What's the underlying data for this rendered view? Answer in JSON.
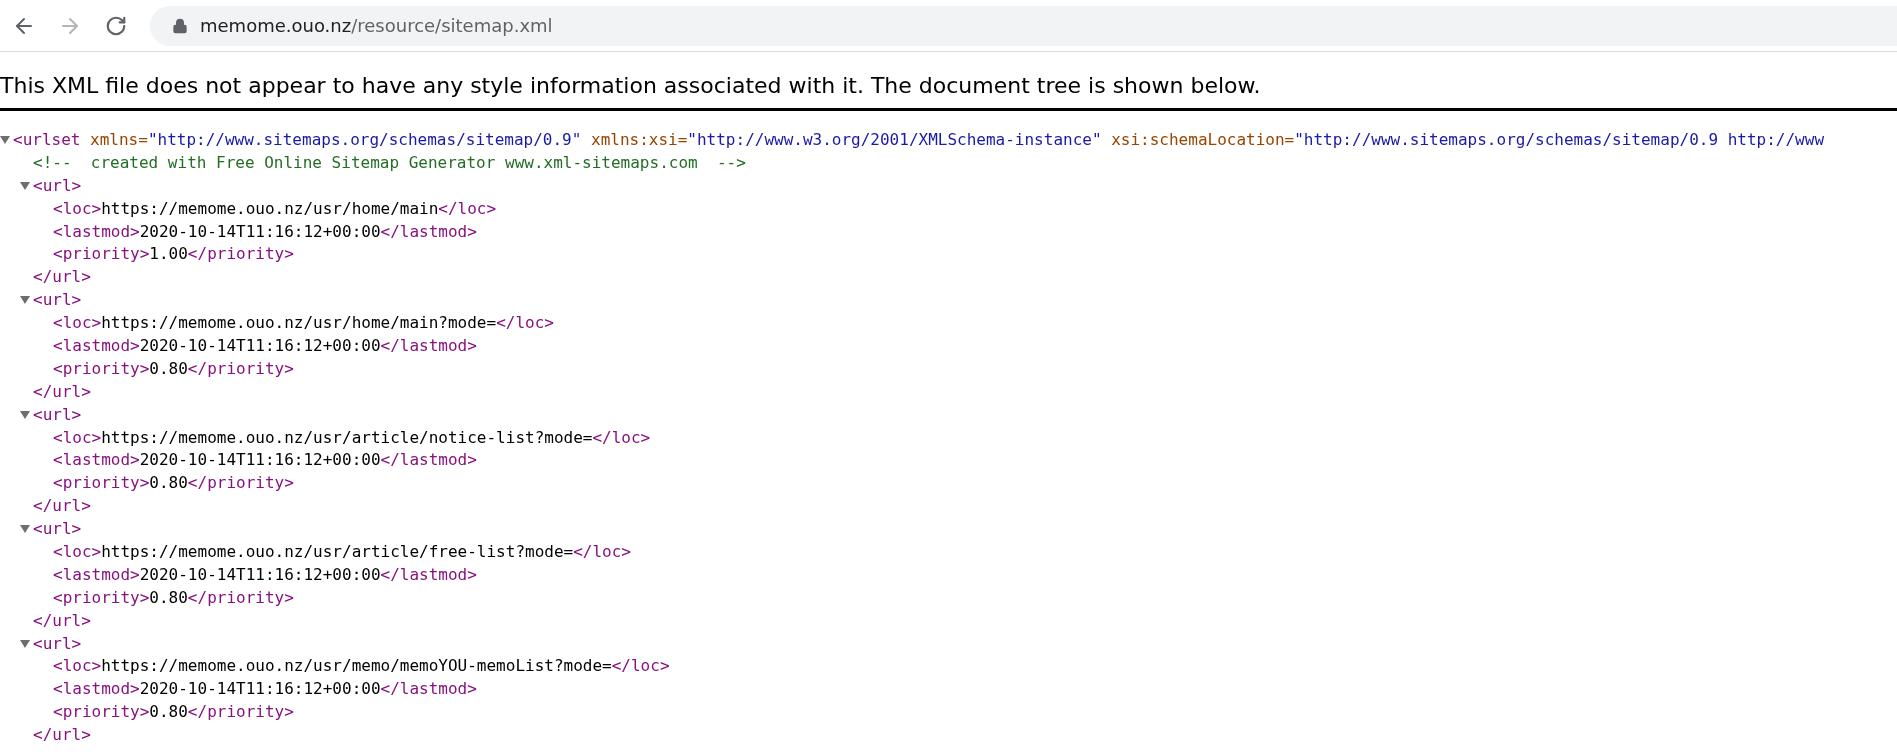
{
  "browser": {
    "back": {
      "disabled": false
    },
    "forward": {
      "disabled": true
    },
    "address": {
      "host": "memome.ouo.nz",
      "path": "/resource/sitemap.xml",
      "secure": true
    }
  },
  "info_message": "This XML file does not appear to have any style information associated with it. The document tree is shown below.",
  "xml_tree": {
    "kind": "element",
    "expanded": true,
    "open": [
      {
        "kind": "tag",
        "text": "<urlset"
      },
      {
        "kind": "attr",
        "text": " xmlns="
      },
      {
        "kind": "value",
        "text": "\"http://www.sitemaps.org/schemas/sitemap/0.9\""
      },
      {
        "kind": "attr",
        "text": " xmlns:xsi="
      },
      {
        "kind": "value",
        "text": "\"http://www.w3.org/2001/XMLSchema-instance\""
      },
      {
        "kind": "attr",
        "text": " xsi:schemaLocation="
      },
      {
        "kind": "value",
        "text": "\"http://www.sitemaps.org/schemas/sitemap/0.9 http://www"
      }
    ],
    "children": [
      {
        "kind": "comment",
        "text": "<!--  created with Free Online Sitemap Generator www.xml-sitemaps.com  -->"
      },
      {
        "kind": "element",
        "expanded": true,
        "open": [
          {
            "kind": "tag",
            "text": "<url>"
          }
        ],
        "close": [
          {
            "kind": "tag",
            "text": "</url>"
          }
        ],
        "children": [
          {
            "kind": "leaf",
            "line": [
              {
                "kind": "tag",
                "text": "<loc>"
              },
              {
                "kind": "text",
                "text": "https://memome.ouo.nz/usr/home/main"
              },
              {
                "kind": "tag",
                "text": "</loc>"
              }
            ]
          },
          {
            "kind": "leaf",
            "line": [
              {
                "kind": "tag",
                "text": "<lastmod>"
              },
              {
                "kind": "text",
                "text": "2020-10-14T11:16:12+00:00"
              },
              {
                "kind": "tag",
                "text": "</lastmod>"
              }
            ]
          },
          {
            "kind": "leaf",
            "line": [
              {
                "kind": "tag",
                "text": "<priority>"
              },
              {
                "kind": "text",
                "text": "1.00"
              },
              {
                "kind": "tag",
                "text": "</priority>"
              }
            ]
          }
        ]
      },
      {
        "kind": "element",
        "expanded": true,
        "open": [
          {
            "kind": "tag",
            "text": "<url>"
          }
        ],
        "close": [
          {
            "kind": "tag",
            "text": "</url>"
          }
        ],
        "children": [
          {
            "kind": "leaf",
            "line": [
              {
                "kind": "tag",
                "text": "<loc>"
              },
              {
                "kind": "text",
                "text": "https://memome.ouo.nz/usr/home/main?mode="
              },
              {
                "kind": "tag",
                "text": "</loc>"
              }
            ]
          },
          {
            "kind": "leaf",
            "line": [
              {
                "kind": "tag",
                "text": "<lastmod>"
              },
              {
                "kind": "text",
                "text": "2020-10-14T11:16:12+00:00"
              },
              {
                "kind": "tag",
                "text": "</lastmod>"
              }
            ]
          },
          {
            "kind": "leaf",
            "line": [
              {
                "kind": "tag",
                "text": "<priority>"
              },
              {
                "kind": "text",
                "text": "0.80"
              },
              {
                "kind": "tag",
                "text": "</priority>"
              }
            ]
          }
        ]
      },
      {
        "kind": "element",
        "expanded": true,
        "open": [
          {
            "kind": "tag",
            "text": "<url>"
          }
        ],
        "close": [
          {
            "kind": "tag",
            "text": "</url>"
          }
        ],
        "children": [
          {
            "kind": "leaf",
            "line": [
              {
                "kind": "tag",
                "text": "<loc>"
              },
              {
                "kind": "text",
                "text": "https://memome.ouo.nz/usr/article/notice-list?mode="
              },
              {
                "kind": "tag",
                "text": "</loc>"
              }
            ]
          },
          {
            "kind": "leaf",
            "line": [
              {
                "kind": "tag",
                "text": "<lastmod>"
              },
              {
                "kind": "text",
                "text": "2020-10-14T11:16:12+00:00"
              },
              {
                "kind": "tag",
                "text": "</lastmod>"
              }
            ]
          },
          {
            "kind": "leaf",
            "line": [
              {
                "kind": "tag",
                "text": "<priority>"
              },
              {
                "kind": "text",
                "text": "0.80"
              },
              {
                "kind": "tag",
                "text": "</priority>"
              }
            ]
          }
        ]
      },
      {
        "kind": "element",
        "expanded": true,
        "open": [
          {
            "kind": "tag",
            "text": "<url>"
          }
        ],
        "close": [
          {
            "kind": "tag",
            "text": "</url>"
          }
        ],
        "children": [
          {
            "kind": "leaf",
            "line": [
              {
                "kind": "tag",
                "text": "<loc>"
              },
              {
                "kind": "text",
                "text": "https://memome.ouo.nz/usr/article/free-list?mode="
              },
              {
                "kind": "tag",
                "text": "</loc>"
              }
            ]
          },
          {
            "kind": "leaf",
            "line": [
              {
                "kind": "tag",
                "text": "<lastmod>"
              },
              {
                "kind": "text",
                "text": "2020-10-14T11:16:12+00:00"
              },
              {
                "kind": "tag",
                "text": "</lastmod>"
              }
            ]
          },
          {
            "kind": "leaf",
            "line": [
              {
                "kind": "tag",
                "text": "<priority>"
              },
              {
                "kind": "text",
                "text": "0.80"
              },
              {
                "kind": "tag",
                "text": "</priority>"
              }
            ]
          }
        ]
      },
      {
        "kind": "element",
        "expanded": true,
        "open": [
          {
            "kind": "tag",
            "text": "<url>"
          }
        ],
        "close": [
          {
            "kind": "tag",
            "text": "</url>"
          }
        ],
        "children": [
          {
            "kind": "leaf",
            "line": [
              {
                "kind": "tag",
                "text": "<loc>"
              },
              {
                "kind": "text",
                "text": "https://memome.ouo.nz/usr/memo/memoYOU-memoList?mode="
              },
              {
                "kind": "tag",
                "text": "</loc>"
              }
            ]
          },
          {
            "kind": "leaf",
            "line": [
              {
                "kind": "tag",
                "text": "<lastmod>"
              },
              {
                "kind": "text",
                "text": "2020-10-14T11:16:12+00:00"
              },
              {
                "kind": "tag",
                "text": "</lastmod>"
              }
            ]
          },
          {
            "kind": "leaf",
            "line": [
              {
                "kind": "tag",
                "text": "<priority>"
              },
              {
                "kind": "text",
                "text": "0.80"
              },
              {
                "kind": "tag",
                "text": "</priority>"
              }
            ]
          }
        ]
      }
    ]
  }
}
